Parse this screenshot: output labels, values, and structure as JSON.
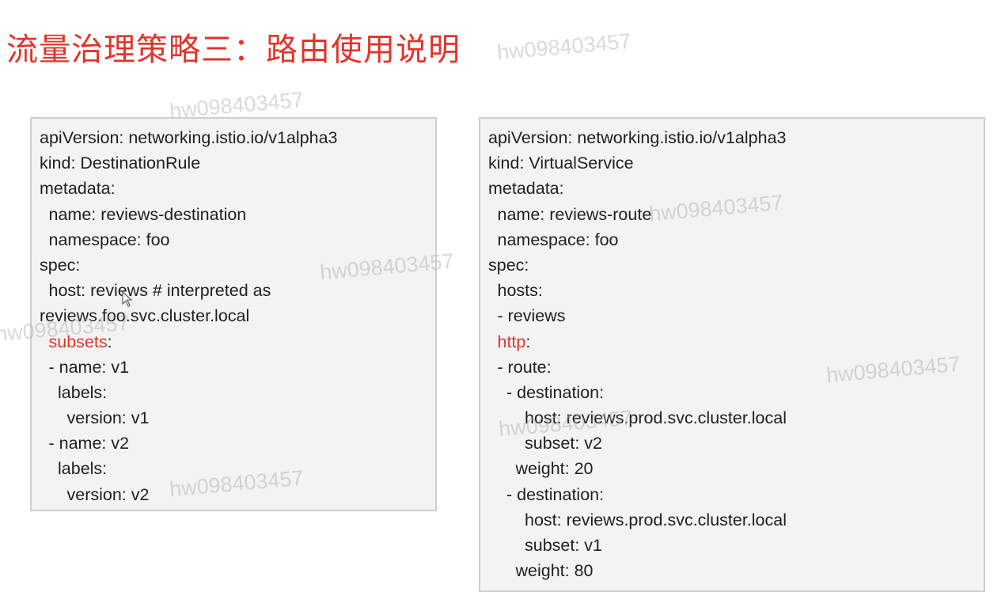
{
  "slide": {
    "title": "流量治理策略三：路由使用说明"
  },
  "left_code": {
    "lines": [
      {
        "indent": 0,
        "pre": "apiVersion: networking.istio.io/v1alpha3",
        "kw": "",
        "post": ""
      },
      {
        "indent": 0,
        "pre": "kind: DestinationRule",
        "kw": "",
        "post": ""
      },
      {
        "indent": 0,
        "pre": "metadata:",
        "kw": "",
        "post": ""
      },
      {
        "indent": 1,
        "pre": "name: reviews-destination",
        "kw": "",
        "post": ""
      },
      {
        "indent": 1,
        "pre": "namespace: foo",
        "kw": "",
        "post": ""
      },
      {
        "indent": 0,
        "pre": "spec:",
        "kw": "",
        "post": ""
      },
      {
        "indent": 1,
        "pre": "host: reviews # interpreted as",
        "kw": "",
        "post": ""
      },
      {
        "indent": 0,
        "pre": "reviews.foo.svc.cluster.local",
        "kw": "",
        "post": ""
      },
      {
        "indent": 1,
        "pre": "",
        "kw": "subsets",
        "post": ":"
      },
      {
        "indent": 1,
        "pre": "- name: v1",
        "kw": "",
        "post": ""
      },
      {
        "indent": 2,
        "pre": "labels:",
        "kw": "",
        "post": ""
      },
      {
        "indent": 3,
        "pre": "version: v1",
        "kw": "",
        "post": ""
      },
      {
        "indent": 1,
        "pre": "- name: v2",
        "kw": "",
        "post": ""
      },
      {
        "indent": 2,
        "pre": "labels:",
        "kw": "",
        "post": ""
      },
      {
        "indent": 3,
        "pre": "version: v2",
        "kw": "",
        "post": ""
      }
    ]
  },
  "right_code": {
    "lines": [
      {
        "indent": 0,
        "pre": "apiVersion: networking.istio.io/v1alpha3",
        "kw": "",
        "post": ""
      },
      {
        "indent": 0,
        "pre": "kind: VirtualService",
        "kw": "",
        "post": ""
      },
      {
        "indent": 0,
        "pre": "metadata:",
        "kw": "",
        "post": ""
      },
      {
        "indent": 1,
        "pre": "name: reviews-route",
        "kw": "",
        "post": ""
      },
      {
        "indent": 1,
        "pre": "namespace: foo",
        "kw": "",
        "post": ""
      },
      {
        "indent": 0,
        "pre": "spec:",
        "kw": "",
        "post": ""
      },
      {
        "indent": 1,
        "pre": "hosts:",
        "kw": "",
        "post": ""
      },
      {
        "indent": 1,
        "pre": "- reviews",
        "kw": "",
        "post": ""
      },
      {
        "indent": 1,
        "pre": "",
        "kw": "http",
        "post": ":"
      },
      {
        "indent": 1,
        "pre": "- route:",
        "kw": "",
        "post": ""
      },
      {
        "indent": 2,
        "pre": "- destination:",
        "kw": "",
        "post": ""
      },
      {
        "indent": 4,
        "pre": "host: reviews.prod.svc.cluster.local",
        "kw": "",
        "post": ""
      },
      {
        "indent": 4,
        "pre": "subset: v2",
        "kw": "",
        "post": ""
      },
      {
        "indent": 3,
        "pre": "weight: 20",
        "kw": "",
        "post": ""
      },
      {
        "indent": 2,
        "pre": "- destination:",
        "kw": "",
        "post": ""
      },
      {
        "indent": 4,
        "pre": "host: reviews.prod.svc.cluster.local",
        "kw": "",
        "post": ""
      },
      {
        "indent": 4,
        "pre": "subset: v1",
        "kw": "",
        "post": ""
      },
      {
        "indent": 3,
        "pre": "weight: 80",
        "kw": "",
        "post": ""
      }
    ]
  },
  "colors": {
    "accent": "#e0352b",
    "text": "#1f1f1f",
    "box_bg": "#f3f3f3",
    "box_border": "#cfcfcf"
  },
  "watermark": {
    "text": "hw098403457"
  },
  "icons": {
    "cursor": "mouse-pointer-icon"
  }
}
